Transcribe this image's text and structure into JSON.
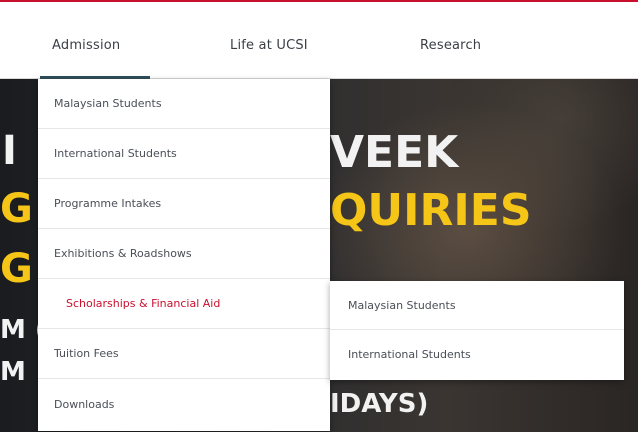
{
  "nav": {
    "items": [
      {
        "label": "Admission"
      },
      {
        "label": "Life at UCSI"
      },
      {
        "label": "Research"
      }
    ]
  },
  "hero": {
    "lines": [
      "I",
      "G",
      "G",
      "VEEK",
      "QUIRIES",
      "M (",
      "M",
      "IDAYS)"
    ]
  },
  "dropdown": {
    "items": [
      {
        "label": "Malaysian Students"
      },
      {
        "label": "International Students"
      },
      {
        "label": "Programme Intakes"
      },
      {
        "label": "Exhibitions & Roadshows"
      },
      {
        "label": "Scholarships & Financial Aid"
      },
      {
        "label": "Tuition Fees"
      },
      {
        "label": "Downloads"
      }
    ]
  },
  "submenu": {
    "items": [
      {
        "label": "Malaysian Students"
      },
      {
        "label": "International Students"
      }
    ]
  },
  "colors": {
    "accent_red": "#c8102e",
    "hero_yellow": "#f5c518",
    "nav_underline": "#2f4f5a"
  }
}
